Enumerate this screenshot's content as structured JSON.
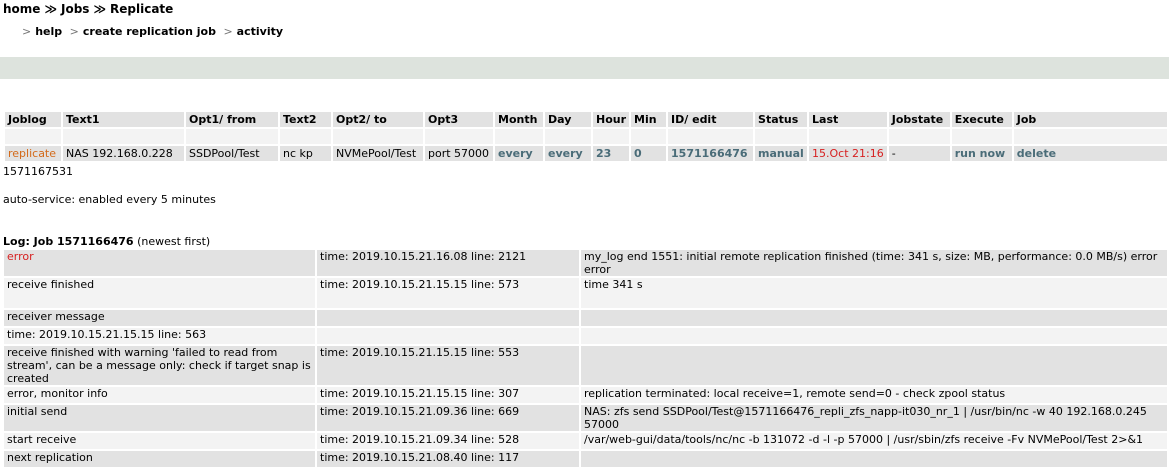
{
  "breadcrumb": {
    "home": "home",
    "jobs": "Jobs",
    "current": "Replicate",
    "sep": "≫"
  },
  "subnav": {
    "items": [
      "help",
      "create replication job",
      "activity"
    ],
    "sep": ">"
  },
  "jobs_table": {
    "headers": [
      "Joblog",
      "Text1",
      "Opt1/ from",
      "Text2",
      "Opt2/ to",
      "Opt3",
      "Month",
      "Day",
      "Hour",
      "Min",
      "ID/ edit",
      "Status",
      "Last",
      "Jobstate",
      "Execute",
      "Job"
    ],
    "row": {
      "joblog": "replicate",
      "text1": "NAS 192.168.0.228",
      "opt1": "SSDPool/Test",
      "text2": "nc kp",
      "opt2": "NVMePool/Test",
      "opt3": "port 57000",
      "month": "every",
      "day": "every",
      "hour": "23",
      "min": "0",
      "id": "1571166476",
      "status": "manual",
      "last": "15.Oct 21:16",
      "jobstate": "-",
      "execute": "run now",
      "job": "delete"
    }
  },
  "id_line": "1571167531",
  "auto_service": "auto-service: enabled every 5 minutes",
  "log": {
    "title": "Log: Job 1571166476",
    "note": "(newest first)",
    "rows": [
      {
        "c1": "error",
        "c2": "time: 2019.10.15.21.16.08 line: 2121",
        "c3": "my_log end 1551: initial remote replication finished (time: 341 s, size: MB, performance: 0.0 MB/s) error error"
      },
      {
        "c1": "receive finished",
        "c2": "time: 2019.10.15.21.15.15 line: 573",
        "c3": "time 341 s"
      },
      {
        "c1": "receiver message",
        "c2": "",
        "c3": ""
      },
      {
        "c1": "time: 2019.10.15.21.15.15 line: 563",
        "c2": "",
        "c3": ""
      },
      {
        "c1": "receive finished with warning 'failed to read from stream', can be a message only: check if target snap is created",
        "c2": "time: 2019.10.15.21.15.15 line: 553",
        "c3": ""
      },
      {
        "c1": "error, monitor info",
        "c2": "time: 2019.10.15.21.15.15 line: 307",
        "c3": "replication terminated: local receive=1, remote send=0 - check zpool status"
      },
      {
        "c1": "initial send",
        "c2": "time: 2019.10.15.21.09.36 line: 669",
        "c3": "NAS: zfs send SSDPool/Test@1571166476_repli_zfs_napp-it030_nr_1 | /usr/bin/nc -w 40 192.168.0.245 57000"
      },
      {
        "c1": "start receive",
        "c2": "time: 2019.10.15.21.09.34 line: 528",
        "c3": "/var/web-gui/data/tools/nc/nc -b 131072 -d -l -p 57000 | /usr/sbin/zfs receive -Fv NVMePool/Test 2>&1"
      },
      {
        "c1": "next replication",
        "c2": "time: 2019.10.15.21.08.40 line: 117",
        "c3": ""
      }
    ]
  }
}
